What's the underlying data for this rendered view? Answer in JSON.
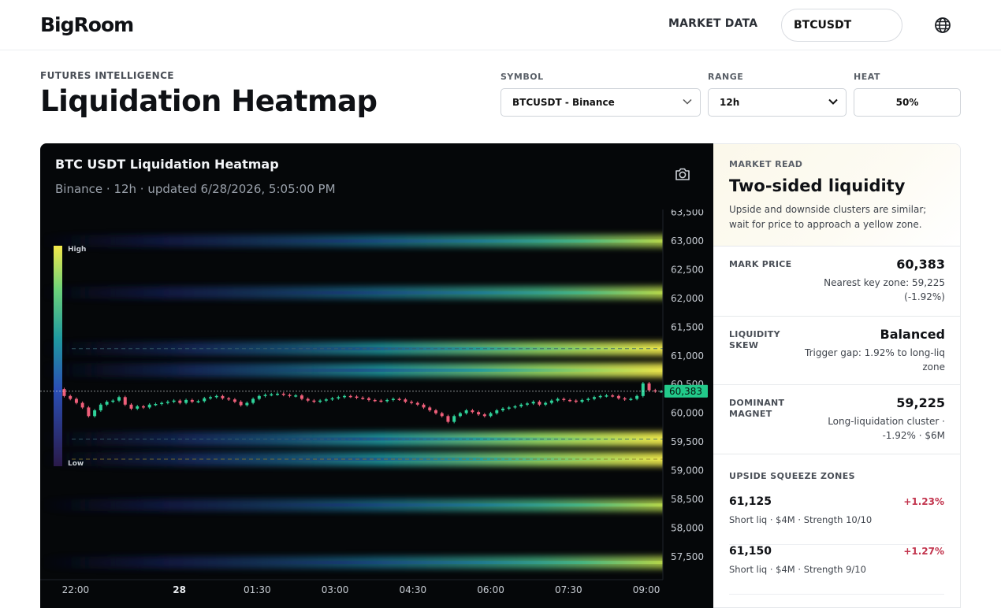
{
  "header": {
    "logo": "BigRoom",
    "nav_link": "MARKET DATA",
    "search_value": "BTCUSDT"
  },
  "page": {
    "eyebrow": "FUTURES INTELLIGENCE",
    "title": "Liquidation Heatmap"
  },
  "controls": {
    "symbol_label": "SYMBOL",
    "symbol_value": "BTCUSDT - Binance",
    "range_label": "RANGE",
    "range_value": "12h",
    "heat_label": "HEAT",
    "heat_value": "50%"
  },
  "chart_card": {
    "title": "BTC USDT Liquidation Heatmap",
    "subtitle": "Binance · 12h · updated 6/28/2026, 5:05:00 PM"
  },
  "chart_data": {
    "type": "heatmap",
    "legend": {
      "high": "High",
      "low": "Low",
      "placement": "top-left"
    },
    "y_ticks": [
      63500,
      63000,
      62500,
      62000,
      61500,
      61000,
      60500,
      60000,
      59500,
      59000,
      58500,
      58000,
      57500
    ],
    "y_tick_labels": [
      "63,500",
      "63,000",
      "62,500",
      "62,000",
      "61,500",
      "61,000",
      "60,500",
      "60,000",
      "59,500",
      "59,000",
      "58,500",
      "58,000",
      "57,500"
    ],
    "ylim": [
      57100,
      63550
    ],
    "x_ticks": [
      {
        "label": "22:00",
        "hours": 0.5,
        "bold": false
      },
      {
        "label": "28",
        "hours": 2.5,
        "bold": true
      },
      {
        "label": "01:30",
        "hours": 4.0,
        "bold": false
      },
      {
        "label": "03:00",
        "hours": 5.5,
        "bold": false
      },
      {
        "label": "04:30",
        "hours": 7.0,
        "bold": false
      },
      {
        "label": "06:00",
        "hours": 8.5,
        "bold": false
      },
      {
        "label": "07:30",
        "hours": 10.0,
        "bold": false
      },
      {
        "label": "09:00",
        "hours": 11.5,
        "bold": false
      }
    ],
    "mark_price": 60383,
    "mark_price_label": "60,383",
    "bands": [
      {
        "price": 63000,
        "intensity": 0.7
      },
      {
        "price": 62100,
        "intensity": 0.75
      },
      {
        "price": 61125,
        "intensity": 0.9
      },
      {
        "price": 60750,
        "intensity": 0.95
      },
      {
        "price": 59550,
        "intensity": 1.0
      },
      {
        "price": 59200,
        "intensity": 0.95
      },
      {
        "price": 58400,
        "intensity": 0.7
      },
      {
        "price": 57400,
        "intensity": 0.7
      }
    ],
    "price_series": [
      60450,
      60420,
      60300,
      60250,
      60180,
      60100,
      59950,
      60050,
      60150,
      60200,
      60220,
      60280,
      60150,
      60080,
      60120,
      60100,
      60150,
      60160,
      60180,
      60200,
      60220,
      60180,
      60230,
      60200,
      60210,
      60260,
      60280,
      60300,
      60260,
      60240,
      60200,
      60140,
      60180,
      60250,
      60300,
      60320,
      60330,
      60340,
      60320,
      60300,
      60310,
      60250,
      60220,
      60200,
      60220,
      60240,
      60260,
      60280,
      60300,
      60290,
      60270,
      60260,
      60230,
      60220,
      60210,
      60230,
      60250,
      60240,
      60200,
      60180,
      60150,
      60100,
      60050,
      60000,
      59950,
      59850,
      59950,
      60000,
      60050,
      60020,
      59980,
      59950,
      60000,
      60050,
      60080,
      60100,
      60120,
      60150,
      60170,
      60200,
      60150,
      60180,
      60220,
      60250,
      60230,
      60220,
      60200,
      60230,
      60250,
      60280,
      60300,
      60310,
      60300,
      60260,
      60240,
      60250,
      60300,
      60520,
      60400,
      60380,
      60383
    ]
  },
  "side": {
    "eyebrow": "MARKET READ",
    "title": "Two-sided liquidity",
    "description": "Upside and downside clusters are similar; wait for price to approach a yellow zone.",
    "metrics": [
      {
        "label": "MARK PRICE",
        "value": "60,383",
        "note": "Nearest key zone: 59,225 (-1.92%)"
      },
      {
        "label": "LIQUIDITY SKEW",
        "value": "Balanced",
        "note": "Trigger gap: 1.92% to long-liq zone"
      },
      {
        "label": "DOMINANT MAGNET",
        "value": "59,225",
        "note": "Long-liquidation cluster · -1.92% · $6M"
      }
    ],
    "zones_title": "UPSIDE SQUEEZE ZONES",
    "zones": [
      {
        "price": "61,125",
        "pct": "+1.23%",
        "desc": "Short liq · $4M · Strength 10/10"
      },
      {
        "price": "61,150",
        "pct": "+1.27%",
        "desc": "Short liq · $4M · Strength 9/10"
      }
    ]
  },
  "colors": {
    "accent_green": "#22c98a",
    "negative_red": "#c2344d",
    "candle_up": "#2fd39a",
    "candle_down": "#ef5f7a"
  },
  "icons": {
    "globe": "globe-icon",
    "camera": "camera-icon",
    "chevron": "chevron-down-icon"
  }
}
